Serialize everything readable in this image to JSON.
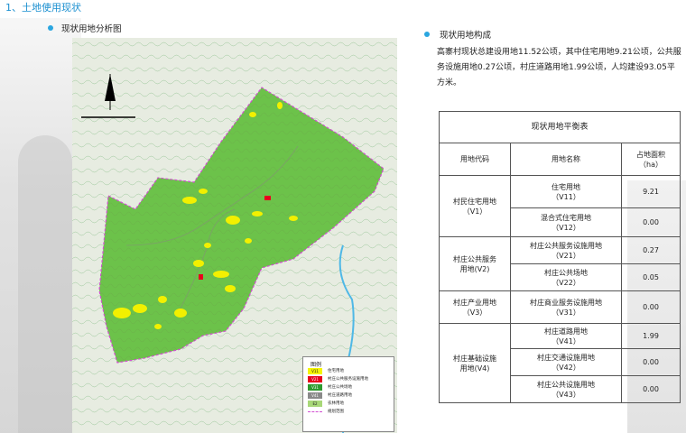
{
  "header": {
    "section_title": "1、土地使用现状"
  },
  "left": {
    "subtitle": "现状用地分析图"
  },
  "map": {
    "legend_title": "图例",
    "legend": [
      {
        "code": "V11",
        "label": "住宅用地",
        "color": "#f5f500"
      },
      {
        "code": "V21",
        "label": "村庄公共服务设施用地",
        "color": "#e8001c"
      },
      {
        "code": "V31",
        "label": "村庄公共场地",
        "color": "#2e9a2e"
      },
      {
        "code": "V41",
        "label": "村庄道路用地",
        "color": "#8a8a8a"
      },
      {
        "code": "E2",
        "label": "农林用地",
        "color": "#a8d878"
      },
      {
        "code": "",
        "label": "规划范围",
        "color": "#d24fd2"
      }
    ]
  },
  "right": {
    "subtitle": "现状用地构成",
    "paragraph": "高寨村现状总建设用地11.52公顷，其中住宅用地9.21公顷，公共服务设施用地0.27公顷，村庄道路用地1.99公顷，人均建设93.05平方米。",
    "table": {
      "title": "现状用地平衡表",
      "headers": [
        "用地代码",
        "用地名称",
        "占地面积",
        "（ha）"
      ],
      "groups": [
        {
          "code": "村民住宅用地",
          "code2": "（V1）",
          "rows": [
            {
              "name": "住宅用地",
              "sub": "（V11）",
              "area": "9.21"
            },
            {
              "name": "混合式住宅用地",
              "sub": "（V12）",
              "area": "0.00"
            }
          ]
        },
        {
          "code": "村庄公共服务",
          "code2": "用地(V2)",
          "rows": [
            {
              "name": "村庄公共服务设施用地",
              "sub": "（V21）",
              "area": "0.27"
            },
            {
              "name": "村庄公共场地",
              "sub": "（V22）",
              "area": "0.05"
            }
          ]
        },
        {
          "code": "村庄产业用地",
          "code2": "（V3）",
          "rows": [
            {
              "name": "村庄商业服务设施用地",
              "sub": "（V31）",
              "area": "0.00"
            }
          ]
        },
        {
          "code": "村庄基础设施",
          "code2": "用地(V4)",
          "rows": [
            {
              "name": "村庄道路用地",
              "sub": "（V41）",
              "area": "1.99"
            },
            {
              "name": "村庄交通设施用地",
              "sub": "（V42）",
              "area": "0.00"
            },
            {
              "name": "村庄公共设施用地",
              "sub": "（V43）",
              "area": "0.00"
            }
          ]
        }
      ]
    }
  }
}
